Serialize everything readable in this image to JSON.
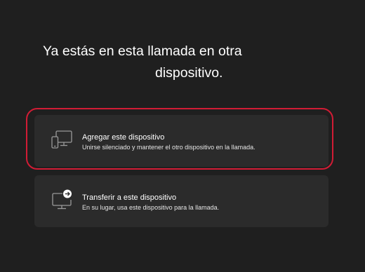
{
  "dialog": {
    "title_line1": "Ya estás en esta llamada en otra",
    "title_line2": "dispositivo."
  },
  "options": [
    {
      "icon": "add-device-icon",
      "title": "Agregar este dispositivo",
      "description": "Unirse silenciado y mantener el otro dispositivo en la llamada."
    },
    {
      "icon": "transfer-device-icon",
      "title": "Transferir a este dispositivo",
      "description": "En su lugar, usa este dispositivo para la llamada."
    }
  ],
  "colors": {
    "background": "#1f1f1f",
    "card": "#2b2b2b",
    "highlight": "#d21c35",
    "text": "#ffffff",
    "icon": "#9a9a9a"
  }
}
